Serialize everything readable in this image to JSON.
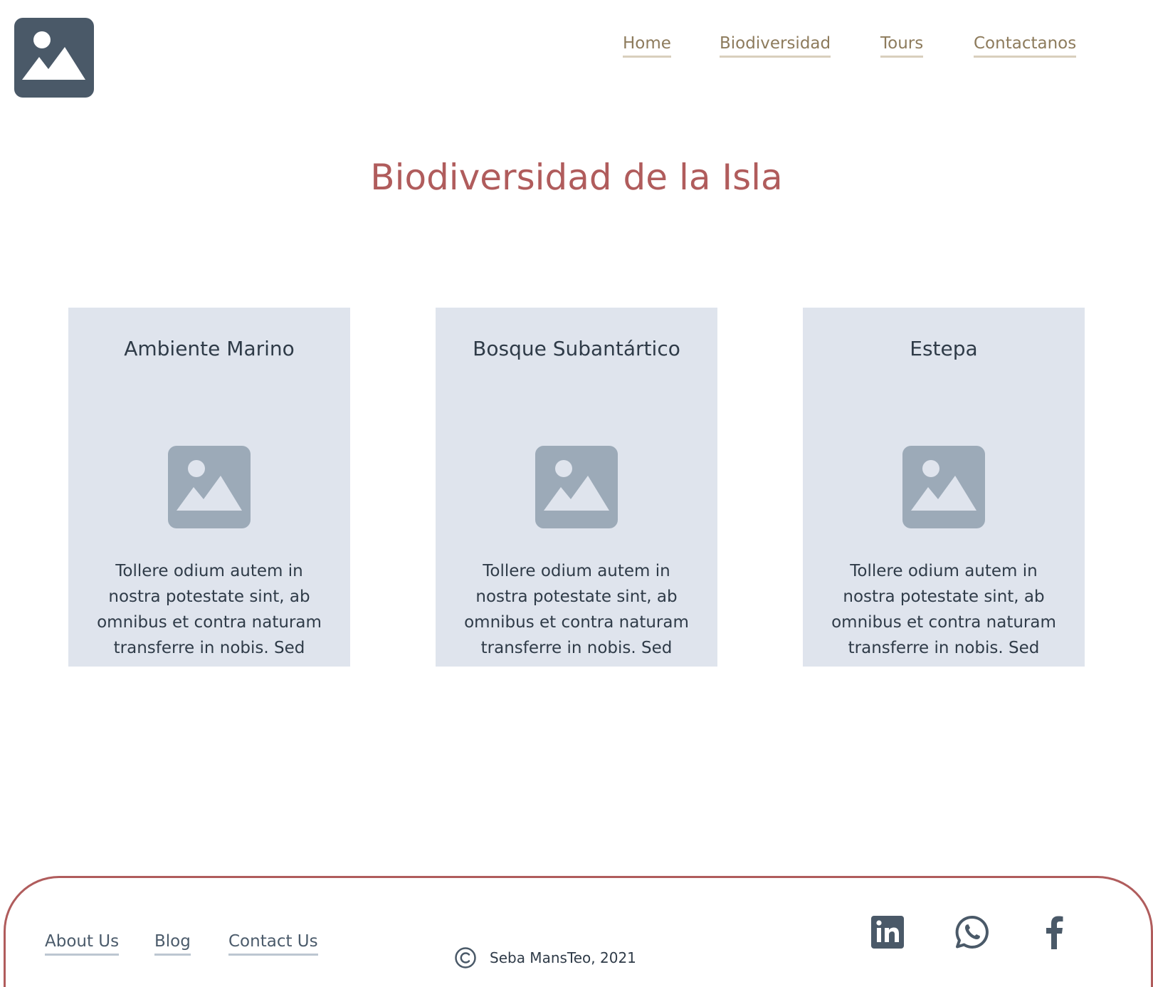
{
  "header": {
    "logo_icon": "image-placeholder-icon",
    "nav": [
      {
        "label": "Home"
      },
      {
        "label": "Biodiversidad"
      },
      {
        "label": "Tours"
      },
      {
        "label": "Contactanos"
      }
    ]
  },
  "main": {
    "title": "Biodiversidad de la Isla",
    "cards": [
      {
        "title": "Ambiente Marino",
        "image_icon": "image-placeholder-icon",
        "text": "Tollere odium autem in nostra potestate sint, ab omnibus et contra naturam transferre in nobis. Sed"
      },
      {
        "title": "Bosque Subantártico",
        "image_icon": "image-placeholder-icon",
        "text": "Tollere odium autem in nostra potestate sint, ab omnibus et contra naturam transferre in nobis. Sed"
      },
      {
        "title": "Estepa",
        "image_icon": "image-placeholder-icon",
        "text": "Tollere odium autem in nostra potestate sint, ab omnibus et contra naturam transferre in nobis. Sed"
      }
    ]
  },
  "footer": {
    "links": [
      {
        "label": "About Us"
      },
      {
        "label": "Blog"
      },
      {
        "label": "Contact Us"
      }
    ],
    "copyright_icon": "copyright-icon",
    "copyright_text": "Seba MansTeo, 2021",
    "social_icons": [
      "linkedin-icon",
      "whatsapp-icon",
      "facebook-icon"
    ]
  },
  "colors": {
    "title": "#b05c5c",
    "nav_link": "#8d7b5c",
    "card_bg": "#dfe4ed",
    "footer_border": "#b05c5c",
    "icon_dark": "#4a5968",
    "icon_light": "#9caab8"
  }
}
